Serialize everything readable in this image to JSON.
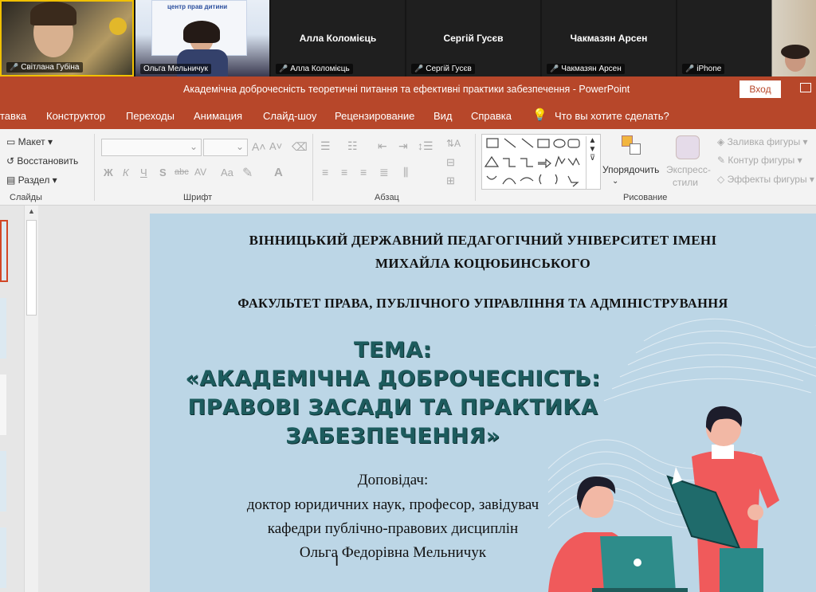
{
  "participants": [
    {
      "name": "Світлана Губіна"
    },
    {
      "name": "Ольга Мельничук"
    },
    {
      "name": "Алла Коломієць",
      "big": "Алла Коломієць"
    },
    {
      "name": "Сергій Гусєв",
      "big": "Сергій Гусєв"
    },
    {
      "name": "Чакмазян Арсен",
      "big": "Чакмазян Арсен"
    },
    {
      "name": "iPhone"
    }
  ],
  "poster_text": "центр прав дитини",
  "window": {
    "title": "Академічна доброчесність теоретичні питання та ефективні практики забезпечення  -  PowerPoint",
    "login": "Вход"
  },
  "menu": [
    "тавка",
    "Конструктор",
    "Переходы",
    "Анимация",
    "Слайд-шоу",
    "Рецензирование",
    "Вид",
    "Справка"
  ],
  "tell_me": "Что вы хотите сделать?",
  "ribbon": {
    "slides": {
      "layout": "Макет",
      "reset": "Восстановить",
      "section": "Раздел",
      "group": "Слайды"
    },
    "font": {
      "bold": "Ж",
      "italic": "К",
      "underline": "Ч",
      "shadow": "S",
      "strike": "abc",
      "spacing": "AV",
      "case": "Aa",
      "group": "Шрифт"
    },
    "paragraph": {
      "group": "Абзац"
    },
    "drawing": {
      "arrange": "Упорядочить",
      "styles1": "Экспресс-",
      "styles2": "стили",
      "fill": "Заливка фигуры",
      "outline": "Контур фигуры",
      "effects": "Эффекты фигуры",
      "group": "Рисование"
    }
  },
  "slide": {
    "uni1": "ВІННИЦЬКИЙ ДЕРЖАВНИЙ ПЕДАГОГІЧНИЙ УНІВЕРСИТЕТ ІМЕНІ",
    "uni2": "МИХАЙЛА КОЦЮБИНСЬКОГО",
    "faculty": "ФАКУЛЬТЕТ ПРАВА, ПУБЛІЧНОГО УПРАВЛІННЯ ТА АДМІНІСТРУВАННЯ",
    "theme1": "ТЕМА:",
    "theme2": "«АКАДЕМІЧНА ДОБРОЧЕСНІСТЬ:",
    "theme3": "ПРАВОВІ ЗАСАДИ ТА ПРАКТИКА",
    "theme4": "ЗАБЕЗПЕЧЕННЯ»",
    "rep1": "Доповідач:",
    "rep2": "доктор юридичних наук, професор, завідувач",
    "rep3": "кафедри публічно-правових дисциплін",
    "rep4": "Ольга Федорівна Мельничук"
  },
  "colors": {
    "accent": "#b7472a",
    "slide_bg": "#bcd6e6",
    "title_teal": "#1d5c5e"
  }
}
